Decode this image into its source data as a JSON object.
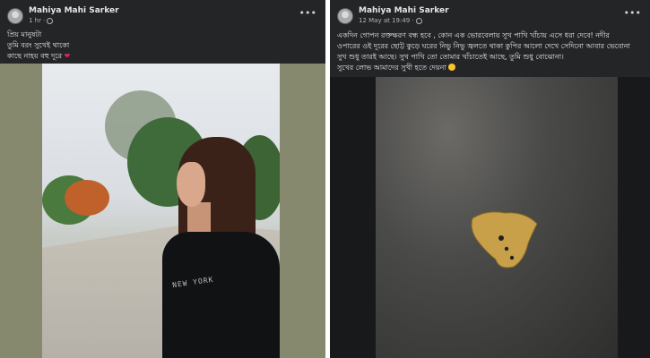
{
  "post_left": {
    "author": "Mahiya Mahi Sarker",
    "time": "1 hr",
    "more_icon": "•••",
    "caption_lines": [
      "প্রিয় মানুষটা",
      "তুমি বরং সুখেই থাকো",
      "কাছে নাহয় বহু দূরে"
    ],
    "heart": "❤",
    "shirt_text": "NEW YORK"
  },
  "post_right": {
    "author": "Mahiya Mahi Sarker",
    "time": "12 May at 19:49",
    "more_icon": "•••",
    "caption_lines": [
      "একদিন গোপন রক্তক্ষরণ বন্ধ হবে , কোন এক ভোরবেলায় সুখ পাখি খাঁচায় এসে ধরা দেবে! নদীর",
      "ওপারের ওই দূরের ছোট্ট কুড়ে ঘরের নিভু নিভু জ্বলতে থাকা কুপির আলো দেখে সেদিনো আবার ভেবোনা",
      "সুখ শুধু তারই আছে। সুখ পাখি তো তোমার খাঁচাতেই আছে, তুমি শুধু বোঝোনা।",
      "সুখের লোভ আমাদের সুখী হতে দেয়না"
    ]
  },
  "colors": {
    "card_bg": "#242526",
    "text_primary": "#e4e6eb",
    "text_secondary": "#b0b3b8",
    "heart": "#e0245e"
  },
  "icons": [
    "avatar",
    "globe-icon",
    "more-options-icon",
    "heart-emoji",
    "sad-face-emoji"
  ]
}
